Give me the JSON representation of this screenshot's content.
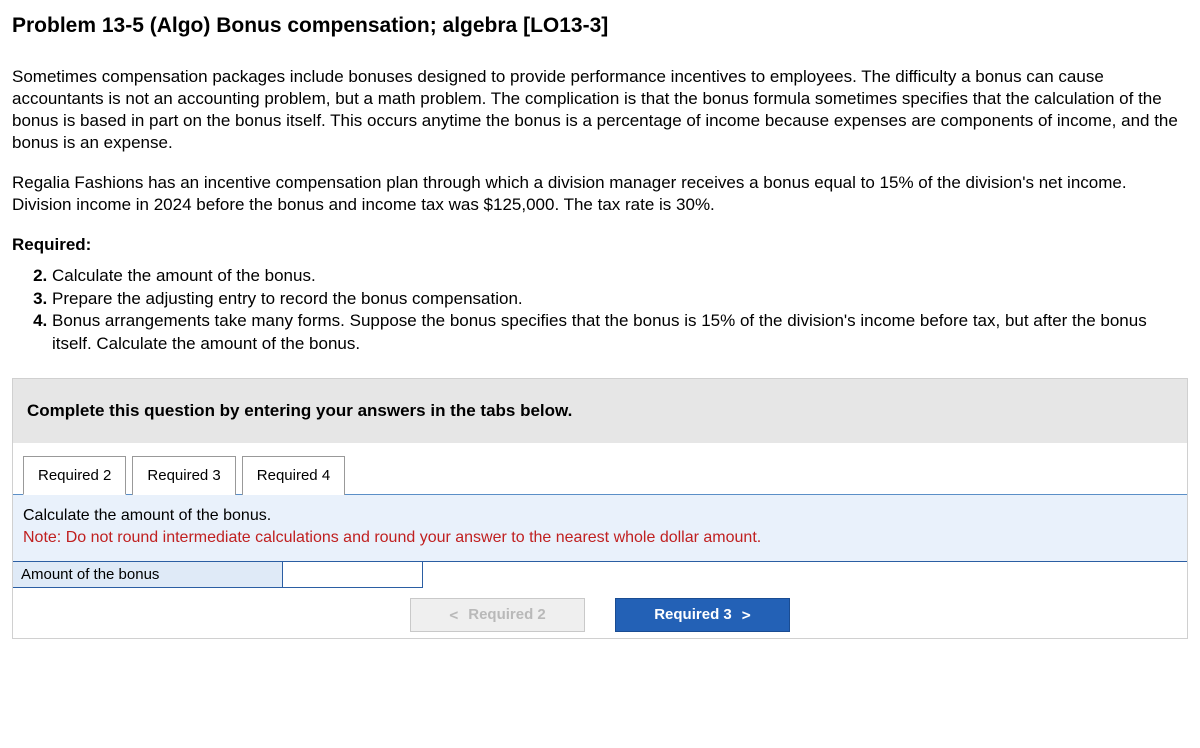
{
  "title": "Problem 13-5 (Algo) Bonus compensation; algebra [LO13-3]",
  "intro": "Sometimes compensation packages include bonuses designed to provide performance incentives to employees. The difficulty a bonus can cause accountants is not an accounting problem, but a math problem. The complication is that the bonus formula sometimes specifies that the calculation of the bonus is based in part on the bonus itself. This occurs anytime the bonus is a percentage of income because expenses are components of income, and the bonus is an expense.",
  "scenario": "Regalia Fashions has an incentive compensation plan through which a division manager receives a bonus equal to 15% of the division's net income. Division income in 2024 before the bonus and income tax was $125,000. The tax rate is 30%.",
  "required_heading": "Required:",
  "requirements": {
    "r2": "Calculate the amount of the bonus.",
    "r3": "Prepare the adjusting entry to record the bonus compensation.",
    "r4": "Bonus arrangements take many forms. Suppose the bonus specifies that the bonus is 15% of the division's income before tax, but after the bonus itself. Calculate the amount of the bonus."
  },
  "instruction_band": "Complete this question by entering your answers in the tabs below.",
  "tabs": {
    "t1": "Required 2",
    "t2": "Required 3",
    "t3": "Required 4"
  },
  "active_tab_content": {
    "line1": "Calculate the amount of the bonus.",
    "note": "Note: Do not round intermediate calculations and round your answer to the nearest whole dollar amount."
  },
  "input_row": {
    "label": "Amount of the bonus",
    "value": ""
  },
  "nav": {
    "prev_label": "Required 2",
    "next_label": "Required 3",
    "chev_left": "<",
    "chev_right": ">"
  }
}
